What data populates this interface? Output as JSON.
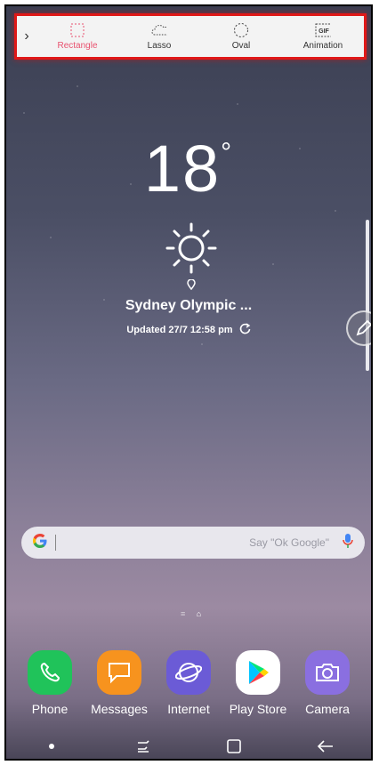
{
  "toolbar": {
    "items": [
      {
        "label": "Rectangle",
        "icon": "rectangle-select-icon",
        "active": true
      },
      {
        "label": "Lasso",
        "icon": "lasso-icon"
      },
      {
        "label": "Oval",
        "icon": "oval-select-icon"
      },
      {
        "label": "Animation",
        "icon": "gif-icon",
        "badge": "GIF"
      }
    ],
    "accent_color": "#e8526f",
    "highlight_border": "#e01818"
  },
  "weather": {
    "temperature": "18",
    "degree_symbol": "°",
    "location": "Sydney Olympic ...",
    "updated": "Updated 27/7 12:58 pm"
  },
  "search": {
    "placeholder": "Say \"Ok Google\""
  },
  "dock": [
    {
      "label": "Phone",
      "color": "#20c35a",
      "icon": "phone-icon"
    },
    {
      "label": "Messages",
      "color": "#f7931e",
      "icon": "messages-icon"
    },
    {
      "label": "Internet",
      "color": "#6b5bd6",
      "icon": "internet-icon"
    },
    {
      "label": "Play Store",
      "color": "#ffffff",
      "icon": "play-store-icon"
    },
    {
      "label": "Camera",
      "color": "#8a6fe0",
      "icon": "camera-icon"
    }
  ]
}
